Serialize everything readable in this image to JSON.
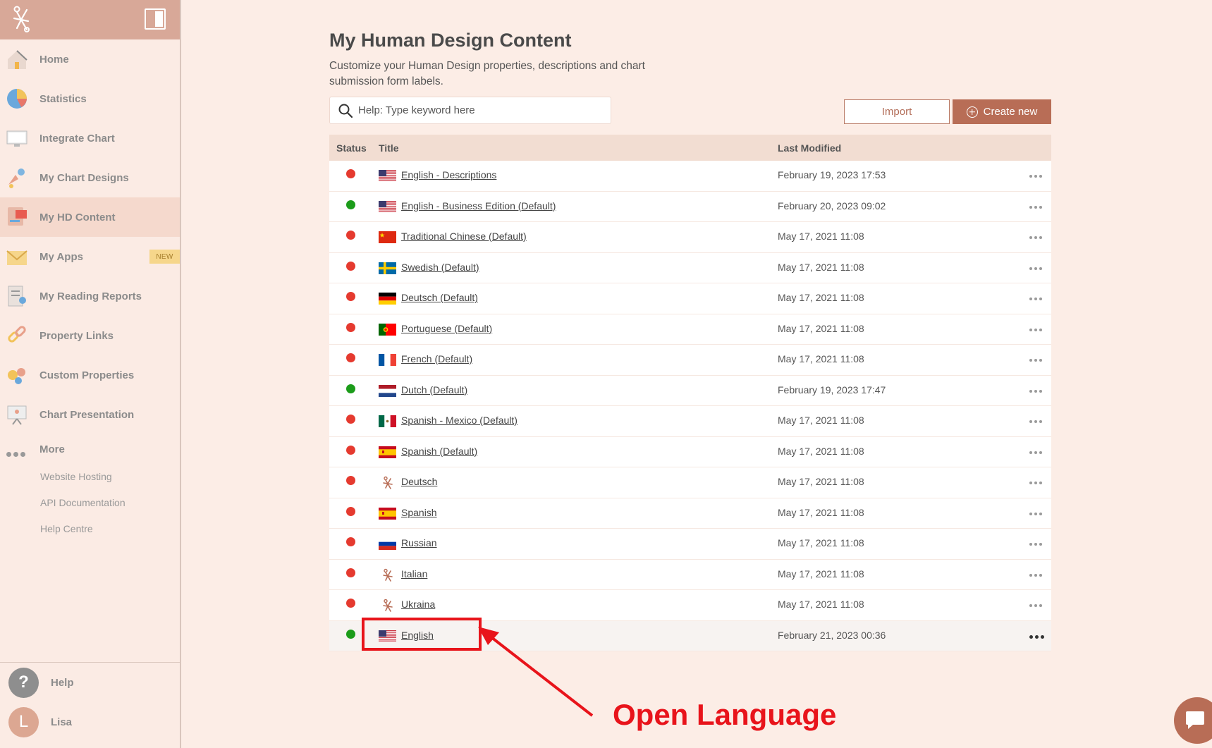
{
  "sidebar": {
    "nav": [
      {
        "label": "Home",
        "icon": "home-icon"
      },
      {
        "label": "Statistics",
        "icon": "pie-chart-icon"
      },
      {
        "label": "Integrate Chart",
        "icon": "monitor-icon"
      },
      {
        "label": "My Chart Designs",
        "icon": "paint-icon"
      },
      {
        "label": "My HD Content",
        "icon": "content-icon"
      },
      {
        "label": "My Apps",
        "icon": "envelope-icon",
        "badge": "NEW"
      },
      {
        "label": "My Reading Reports",
        "icon": "report-icon"
      },
      {
        "label": "Property Links",
        "icon": "link-icon"
      },
      {
        "label": "Custom Properties",
        "icon": "properties-icon"
      },
      {
        "label": "Chart Presentation",
        "icon": "presentation-icon"
      }
    ],
    "more_label": "More",
    "more_links": [
      "Website Hosting",
      "API Documentation",
      "Help Centre"
    ],
    "help_label": "Help",
    "help_glyph": "?",
    "user_name": "Lisa",
    "user_initial": "L"
  },
  "main": {
    "title": "My Human Design Content",
    "description": "Customize your Human Design properties, descriptions and chart submission form labels.",
    "search_placeholder": "Help: Type keyword here",
    "import_label": "Import",
    "create_label": "Create new"
  },
  "table": {
    "headers": {
      "status": "Status",
      "title": "Title",
      "modified": "Last Modified"
    },
    "rows": [
      {
        "status": "red",
        "flag": "us",
        "title": "English - Descriptions",
        "modified": "February 19, 2023 17:53"
      },
      {
        "status": "green",
        "flag": "us",
        "title": "English - Business Edition (Default)",
        "modified": "February 20, 2023 09:02"
      },
      {
        "status": "red",
        "flag": "cn",
        "title": "Traditional Chinese (Default)",
        "modified": "May 17, 2021 11:08"
      },
      {
        "status": "red",
        "flag": "se",
        "title": "Swedish (Default)",
        "modified": "May 17, 2021 11:08"
      },
      {
        "status": "red",
        "flag": "de",
        "title": "Deutsch (Default)",
        "modified": "May 17, 2021 11:08"
      },
      {
        "status": "red",
        "flag": "pt",
        "title": "Portuguese (Default)",
        "modified": "May 17, 2021 11:08"
      },
      {
        "status": "red",
        "flag": "fr",
        "title": "French (Default)",
        "modified": "May 17, 2021 11:08"
      },
      {
        "status": "green",
        "flag": "nl",
        "title": "Dutch (Default)",
        "modified": "February 19, 2023 17:47"
      },
      {
        "status": "red",
        "flag": "mx",
        "title": "Spanish - Mexico (Default)",
        "modified": "May 17, 2021 11:08"
      },
      {
        "status": "red",
        "flag": "es",
        "title": "Spanish (Default)",
        "modified": "May 17, 2021 11:08"
      },
      {
        "status": "red",
        "flag": "hd",
        "title": "Deutsch",
        "modified": "May 17, 2021 11:08"
      },
      {
        "status": "red",
        "flag": "es",
        "title": "Spanish",
        "modified": "May 17, 2021 11:08"
      },
      {
        "status": "red",
        "flag": "ru",
        "title": "Russian",
        "modified": "May 17, 2021 11:08"
      },
      {
        "status": "red",
        "flag": "hd",
        "title": "Italian",
        "modified": "May 17, 2021 11:08"
      },
      {
        "status": "red",
        "flag": "hd",
        "title": "Ukraina",
        "modified": "May 17, 2021 11:08"
      },
      {
        "status": "green",
        "flag": "us",
        "title": "English",
        "modified": "February 21, 2023 00:36",
        "highlighted": true
      }
    ]
  },
  "annotation": {
    "text": "Open Language",
    "color": "#e8141b"
  },
  "colors": {
    "accent": "#b86d56",
    "sidebar_header": "#d8a898",
    "background": "#fcede6",
    "status_red": "#e53a2f",
    "status_green": "#1c9c1a"
  }
}
